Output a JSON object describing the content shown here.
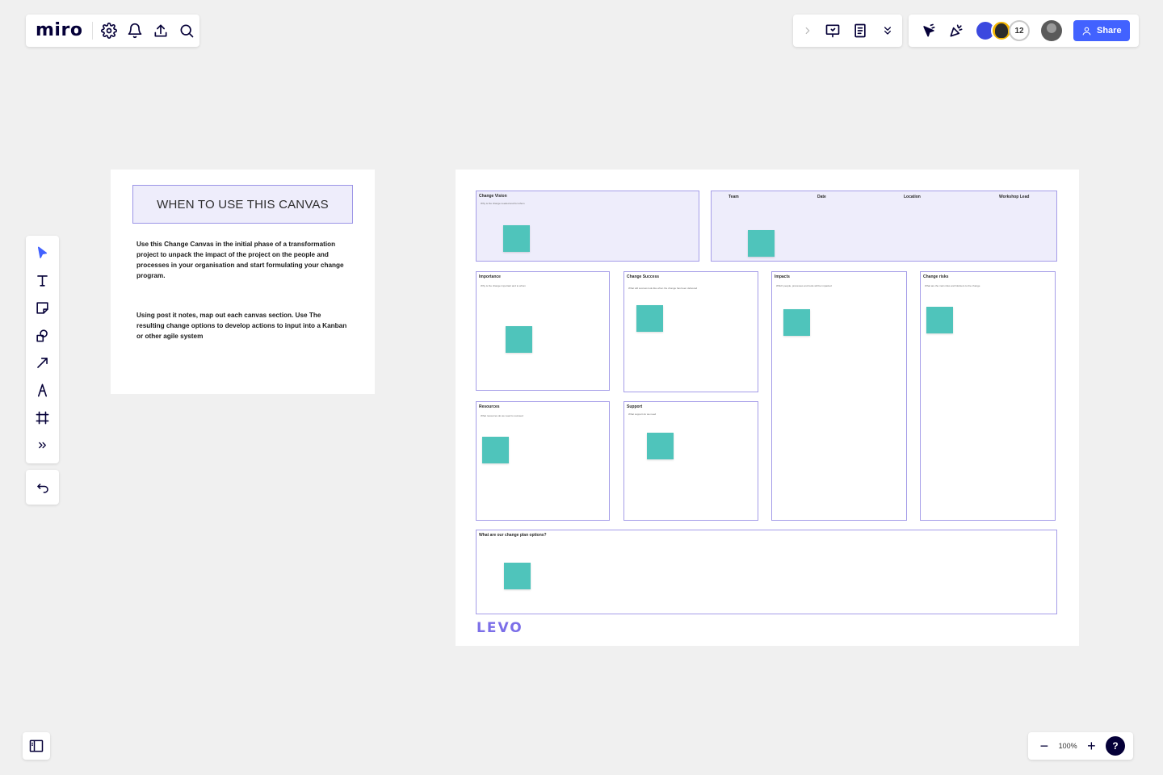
{
  "app": {
    "logo": "miro"
  },
  "topbar": {
    "share_label": "Share",
    "collaborator_count": "12"
  },
  "zoom": {
    "minus": "−",
    "level": "100%",
    "plus": "+",
    "help": "?"
  },
  "info": {
    "title": "WHEN TO USE THIS CANVAS",
    "paragraph1": "Use this Change Canvas in the initial phase of a transformation project to unpack the impact of the project on the people and processes in your organisation and start formulating your change program.",
    "paragraph2": "Using post it notes, map out each canvas section. Use The resulting change options to develop actions to input into a Kanban or other agile system"
  },
  "canvas": {
    "change_vision": {
      "title": "Change Vision",
      "sub": "Why is the change needed and for whom"
    },
    "header": {
      "team": "Team",
      "date": "Date",
      "location": "Location",
      "workshop_lead": "Workshop Lead"
    },
    "importance": {
      "title": "Importance",
      "sub": "Why is the change important and to whom"
    },
    "change_success": {
      "title": "Change Success",
      "sub": "What will success look like when the change has been delivered"
    },
    "impacts": {
      "title": "Impacts",
      "sub": "Which people, processes and tools will be impacted"
    },
    "change_risks": {
      "title": "Change risks",
      "sub": "What are the main risks and blockers to the change"
    },
    "resources": {
      "title": "Resources",
      "sub": "What resources do we need to succeed"
    },
    "support": {
      "title": "Support",
      "sub": "What support do we need"
    },
    "options": {
      "title": "What are our change plan options?"
    },
    "brand": "LEVO"
  }
}
